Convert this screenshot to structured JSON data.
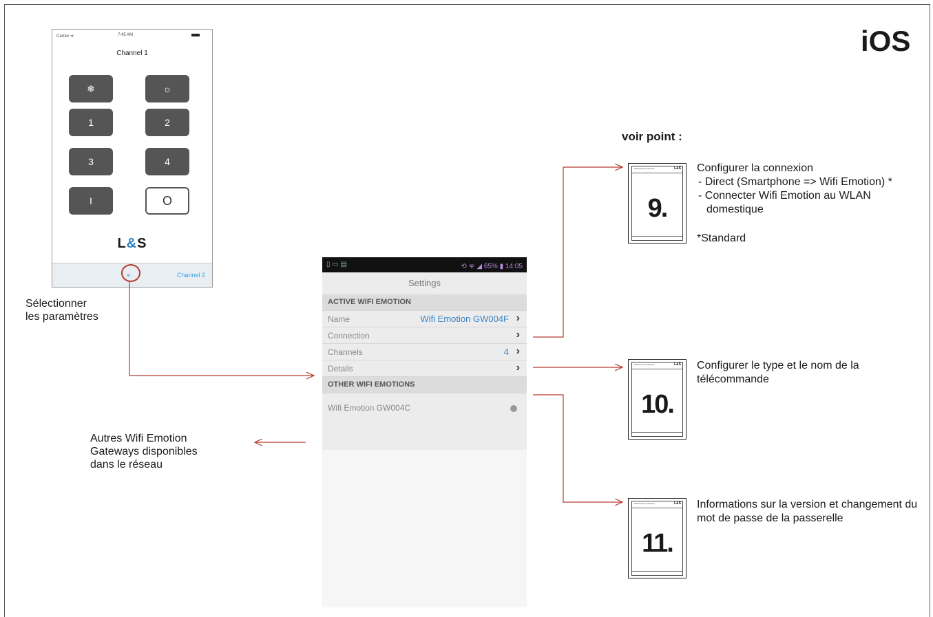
{
  "platform_tag": "iOS",
  "phone": {
    "carrier": "Carrier ᯤ",
    "time": "7:45 AM",
    "title": "Channel 1",
    "buttons": [
      "❄",
      "☼",
      "1",
      "2",
      "3",
      "4",
      "I",
      "O"
    ],
    "brand_a": "L",
    "brand_amp": "&",
    "brand_b": "S",
    "menu_icon": "≡",
    "tab_right": "Channel 2"
  },
  "caption_left": [
    "Sélectionner",
    "les paramètres"
  ],
  "settings": {
    "status_left": "▯ ▭ ▤",
    "status_right": "⟲ ᯤ ◢ 65% ▮ 14:05",
    "title": "Settings",
    "active_header": "ACTIVE WIFI EMOTION",
    "rows": [
      {
        "key": "Name",
        "value": "Wifi Emotion GW004F"
      },
      {
        "key": "Connection",
        "value": ""
      },
      {
        "key": "Channels",
        "value": "4"
      },
      {
        "key": "Details",
        "value": ""
      }
    ],
    "other_header": "OTHER WIFI EMOTIONS",
    "other_row": "Wifi Emotion GW004C"
  },
  "caption_other": [
    "Autres Wifi Emotion",
    "Gateways disponibles",
    "dans le réseau"
  ],
  "voir_point": "voir point :",
  "refs": [
    {
      "num": "9.",
      "lines": [
        "Configurer la connexion"
      ],
      "bullets": [
        "- Direct (Smartphone => Wifi Emotion) *",
        "- Connecter Wifi Emotion au WLAN domestique"
      ],
      "note": "*Standard"
    },
    {
      "num": "10.",
      "lines": [
        "Configurer le type et le nom de la télécommande"
      ]
    },
    {
      "num": "11.",
      "lines": [
        "Informations sur la version et changement du mot de passe de la passerelle"
      ]
    }
  ],
  "booklet_corner": "L&S",
  "booklet_header": "Wifi Emotion Gateway",
  "colors": {
    "arrow": "#b33a2e",
    "link_blue": "#3a84c6"
  }
}
